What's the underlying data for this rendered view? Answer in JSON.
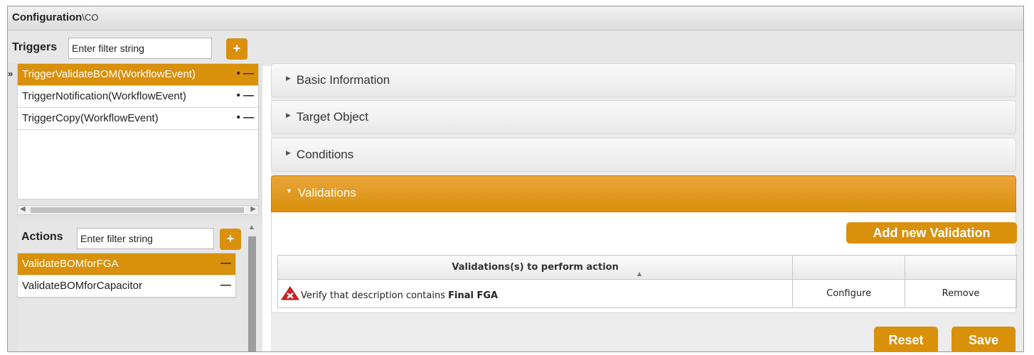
{
  "title": {
    "main": "Configuration",
    "sub": "\\CO"
  },
  "triggers": {
    "label": "Triggers",
    "filter_placeholder": "Enter filter string",
    "add_symbol": "+",
    "collapse_symbol": "»",
    "items": [
      {
        "label": "TriggerValidateBOM(WorkflowEvent)",
        "selected": true,
        "controls": "• —"
      },
      {
        "label": "TriggerNotification(WorkflowEvent)",
        "selected": false,
        "controls": "• —"
      },
      {
        "label": "TriggerCopy(WorkflowEvent)",
        "selected": false,
        "controls": "• —"
      }
    ]
  },
  "actions": {
    "label": "Actions",
    "filter_placeholder": "Enter filter string",
    "add_symbol": "+",
    "items": [
      {
        "label": "ValidateBOMforFGA",
        "selected": true,
        "controls": "—"
      },
      {
        "label": "ValidateBOMforCapacitor",
        "selected": false,
        "controls": "—"
      }
    ]
  },
  "sections": [
    {
      "label": "Basic Information",
      "open": false
    },
    {
      "label": "Target Object",
      "open": false
    },
    {
      "label": "Conditions",
      "open": false
    },
    {
      "label": "Validations",
      "open": true
    }
  ],
  "validations": {
    "add_button": "Add new Validation",
    "column_header": "Validations(s) to perform action",
    "rows": [
      {
        "text": "Verify that description contains ",
        "highlight": "Final FGA",
        "configure": "Configure",
        "remove": "Remove",
        "status_icon": "error-warning-icon"
      }
    ]
  },
  "footer": {
    "reset": "Reset",
    "save": "Save"
  },
  "colors": {
    "accent": "#d9900a",
    "link": "#b26f00",
    "error": "#d42020"
  }
}
